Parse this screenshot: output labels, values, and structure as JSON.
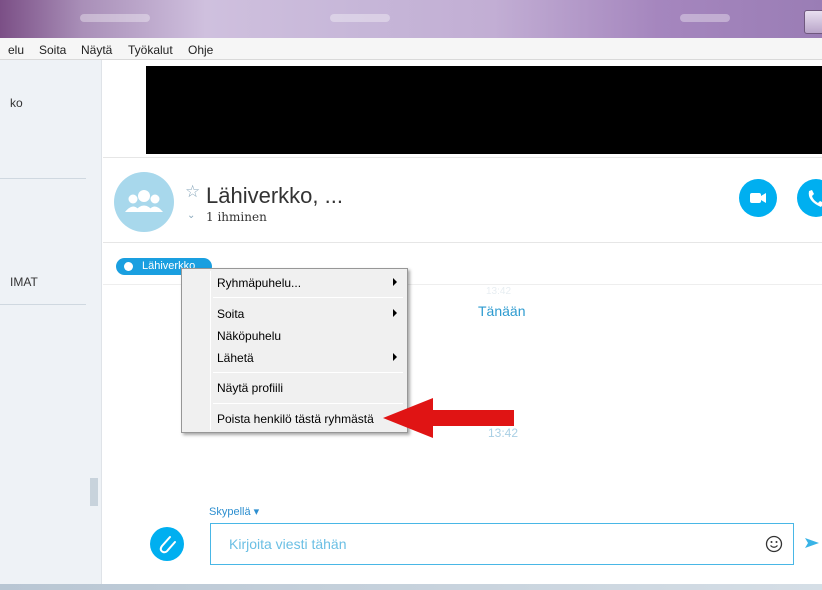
{
  "window": {
    "titlebar_colors": [
      "#7b4f86",
      "#cfc0de",
      "#9a7db5"
    ]
  },
  "menubar": {
    "items": [
      "elu",
      "Soita",
      "Näytä",
      "Työkalut",
      "Ohje"
    ]
  },
  "sidebar": {
    "item_top": "ko",
    "item_mid": "IMAT"
  },
  "conversation": {
    "title": "Lähiverkko, ...",
    "member_count": "1 ihminen",
    "chip_label": "Lähiverkko",
    "date_label": "Tänään",
    "time_label": "13:42",
    "faint_time": "13:42"
  },
  "context_menu": {
    "items": [
      {
        "label": "Ryhmäpuhelu...",
        "submenu": true
      },
      {
        "label": "Soita",
        "submenu": true
      },
      {
        "label": "Näköpuhelu",
        "submenu": false
      },
      {
        "label": "Lähetä",
        "submenu": true
      },
      {
        "label": "Näytä profiili",
        "submenu": false
      },
      {
        "label": "Poista henkilö tästä ryhmästä",
        "submenu": false
      }
    ]
  },
  "composer": {
    "mode_label": "Skypellä ▾",
    "placeholder": "Kirjoita viesti tähän"
  },
  "icons": {
    "avatar": "group-icon",
    "favorite": "star-outline-icon",
    "video": "video-camera-icon",
    "call": "phone-icon",
    "attach": "paperclip-icon",
    "emoji": "smiley-icon",
    "send": "send-arrow-icon",
    "annotation": "red-arrow-pointer"
  },
  "colors": {
    "accent": "#00aff0",
    "chip": "#1a9fe0",
    "annotation_arrow": "#e01414"
  }
}
